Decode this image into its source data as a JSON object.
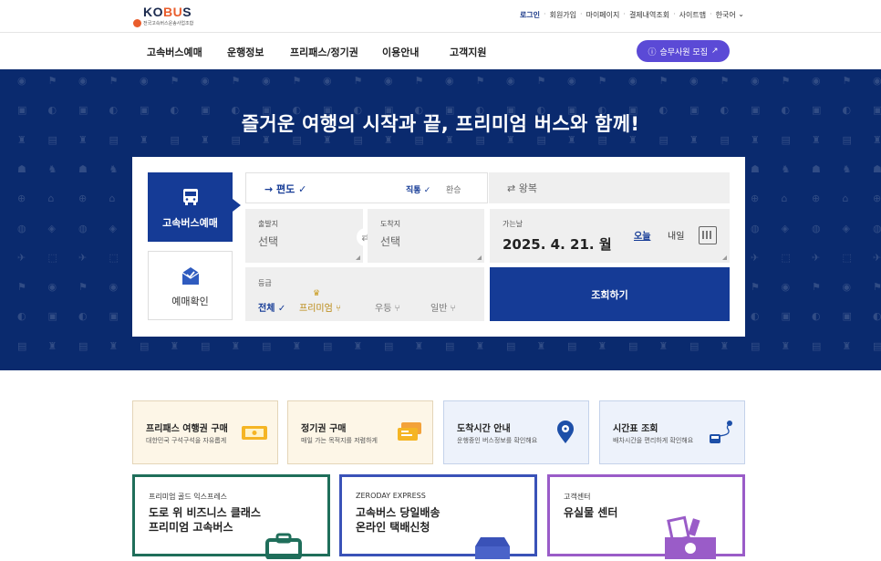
{
  "logo": {
    "name": "KOBUS",
    "accent": "BU",
    "sub": "전국고속버스운송사업조합"
  },
  "utils": {
    "login": "로그인",
    "signup": "회원가입",
    "mypage": "마이페이지",
    "payment": "결제내역조회",
    "sitemap": "사이트맵",
    "lang": "한국어"
  },
  "nav": {
    "items": [
      "고속버스예매",
      "운행정보",
      "프리패스/정기권",
      "이용안내",
      "고객지원"
    ],
    "recruit": "승무사원 모집"
  },
  "hero": {
    "title": "즐거운 여행의 시작과 끝, 프리미엄 버스와 함께!"
  },
  "booking": {
    "tab_book": "고속버스예매",
    "tab_check": "예매확인",
    "one_way": "→ 편도 ✓",
    "direct": "직통 ✓",
    "transfer": "환승",
    "round_trip": "⇄ 왕복",
    "depart_label": "출발지",
    "depart_value": "선택",
    "arrive_label": "도착지",
    "arrive_value": "선택",
    "date_label": "가는날",
    "date_value": "2025. 4. 21. 월",
    "today": "오늘",
    "tomorrow": "내일",
    "grade_label": "등급",
    "grades": {
      "all": "전체 ✓",
      "premium": "프리미엄",
      "excellent": "우등",
      "general": "일반"
    },
    "search": "조회하기"
  },
  "quick": [
    {
      "title": "프리패스 여행권 구매",
      "desc": "대한민국 구석구석을 자유롭게"
    },
    {
      "title": "정기권 구매",
      "desc": "매일 가는 목적지를 저렴하게"
    },
    {
      "title": "도착시간 안내",
      "desc": "운행중인 버스정보를 확인해요"
    },
    {
      "title": "시간표 조회",
      "desc": "배차시간을 편리하게 확인해요"
    }
  ],
  "promos": [
    {
      "small": "프리미엄 골드 익스프레스",
      "big1": "도로 위 비즈니스 클래스",
      "big2": "프리미엄 고속버스"
    },
    {
      "small": "ZERODAY EXPRESS",
      "big1": "고속버스 당일배송",
      "big2": "온라인 택배신청"
    },
    {
      "small": "고객센터",
      "big1": "유실물 센터",
      "big2": ""
    }
  ],
  "colors": {
    "primary": "#153b96",
    "hero": "#0a2a6e",
    "recruit": "#5b4ad6",
    "gold": "#b8860b",
    "green": "#1f6e5a",
    "blue": "#3a52b8",
    "purple": "#9a5cc8"
  }
}
